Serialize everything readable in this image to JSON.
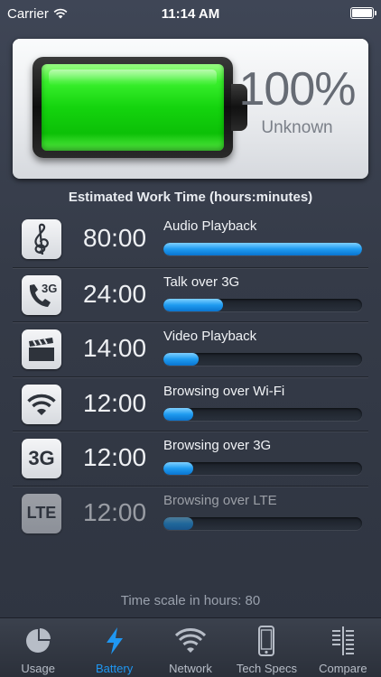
{
  "statusbar": {
    "carrier": "Carrier",
    "time": "11:14 AM",
    "battery_level": 1.0
  },
  "battery": {
    "percent_text": "100%",
    "state_text": "Unknown",
    "level": 1.0,
    "cell_color": "#14d40e"
  },
  "section_title": "Estimated Work Time (hours:minutes)",
  "rows": [
    {
      "icon": "music-note-icon",
      "time": "80:00",
      "label": "Audio Playback",
      "fraction": 1.0
    },
    {
      "icon": "phone-3g-icon",
      "time": "24:00",
      "label": "Talk over 3G",
      "fraction": 0.3
    },
    {
      "icon": "clapperboard-icon",
      "time": "14:00",
      "label": "Video Playback",
      "fraction": 0.175
    },
    {
      "icon": "wifi-icon",
      "time": "12:00",
      "label": "Browsing over Wi-Fi",
      "fraction": 0.15
    },
    {
      "icon": "3g-icon",
      "time": "12:00",
      "label": "Browsing over 3G",
      "fraction": 0.15,
      "icon_text": "3G"
    },
    {
      "icon": "lte-icon",
      "time": "12:00",
      "label": "Browsing over LTE",
      "fraction": 0.15,
      "icon_text": "LTE",
      "dimmed": true
    }
  ],
  "scale_text": "Time scale in hours: 80",
  "tabs": [
    {
      "label": "Usage",
      "icon": "pie-chart-icon",
      "active": false
    },
    {
      "label": "Battery",
      "icon": "lightning-icon",
      "active": true
    },
    {
      "label": "Network",
      "icon": "wifi-icon",
      "active": false
    },
    {
      "label": "Tech Specs",
      "icon": "phone-icon",
      "active": false
    },
    {
      "label": "Compare",
      "icon": "compare-icon",
      "active": false
    }
  ],
  "colors": {
    "accent": "#1f97f2",
    "bar": "#1e9bf0"
  }
}
